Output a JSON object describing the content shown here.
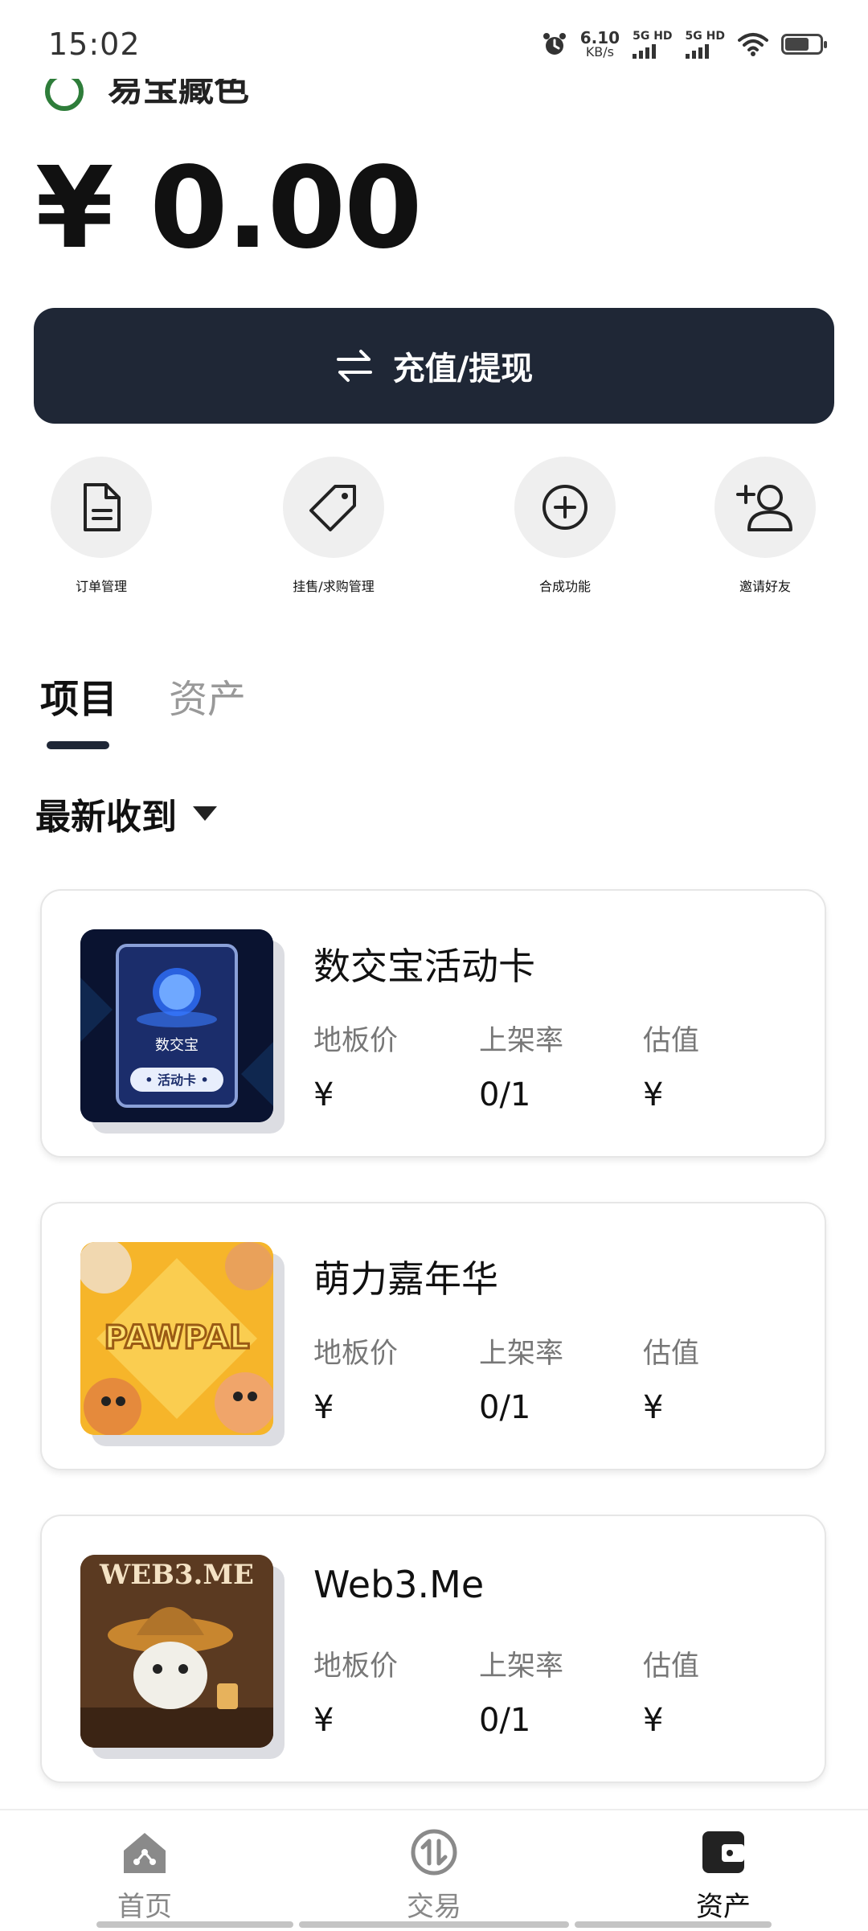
{
  "status_bar": {
    "time": "15:02",
    "net_speed_value": "6.10",
    "net_speed_unit": "KB/s",
    "sim1_label": "5G HD",
    "sim2_label": "5G HD",
    "icons": [
      "alarm-icon",
      "signal-icon",
      "wifi-icon",
      "battery-icon"
    ],
    "battery_level": 0.7
  },
  "header": {
    "brand_name": "易宝藏色"
  },
  "balance": {
    "amount": "¥ 0.00"
  },
  "primary_action": {
    "label": "充值/提现",
    "icon": "swap-arrows-icon"
  },
  "quick_actions": [
    {
      "label": "订单管理",
      "icon": "document-icon"
    },
    {
      "label": "挂售/求购管理",
      "icon": "tag-icon"
    },
    {
      "label": "合成功能",
      "icon": "plus-circle-icon"
    },
    {
      "label": "邀请好友",
      "icon": "add-user-icon"
    }
  ],
  "tabs": [
    {
      "label": "项目",
      "active": true
    },
    {
      "label": "资产",
      "active": false
    }
  ],
  "sort": {
    "label": "最新收到"
  },
  "stat_labels": {
    "floor_price": "地板价",
    "listing_rate": "上架率",
    "estimate": "估值"
  },
  "cards": [
    {
      "title": "数交宝活动卡",
      "floor_price": "¥",
      "listing_rate": "0/1",
      "estimate": "¥",
      "thumb_text1": "数交宝",
      "thumb_text2": "• 活动卡 •"
    },
    {
      "title": "萌力嘉年华",
      "floor_price": "¥",
      "listing_rate": "0/1",
      "estimate": "¥",
      "thumb_text1": "PAWPAL"
    },
    {
      "title": "Web3.Me",
      "floor_price": "¥",
      "listing_rate": "0/1",
      "estimate": "¥",
      "thumb_text1": "WEB3.ME"
    }
  ],
  "bottom_nav": [
    {
      "label": "首页",
      "icon": "home-icon",
      "active": false
    },
    {
      "label": "交易",
      "icon": "exchange-icon",
      "active": false
    },
    {
      "label": "资产",
      "icon": "wallet-icon",
      "active": true
    }
  ],
  "colors": {
    "primary_dark": "#1f2736",
    "brand_green": "#2e7d3a"
  }
}
